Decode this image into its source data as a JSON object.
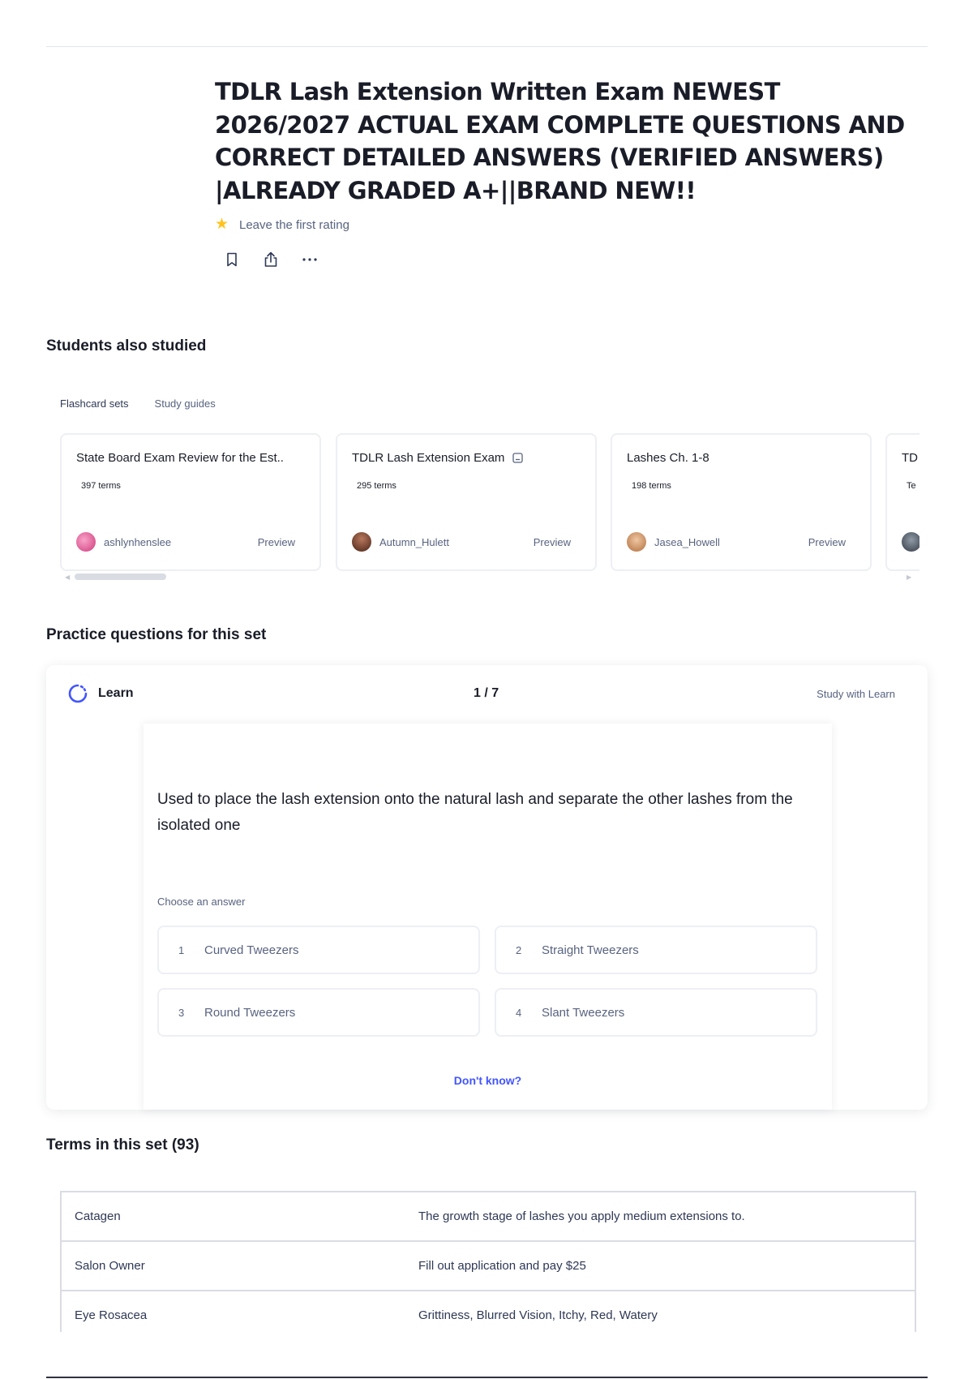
{
  "header": {
    "title": "TDLR Lash Extension Written Exam NEWEST 2026/2027 ACTUAL EXAM COMPLETE QUESTIONS AND CORRECT DETAILED ANSWERS (VERIFIED ANSWERS) |ALREADY GRADED A+||BRAND NEW!!",
    "rating_prompt": "Leave the first rating",
    "actions": [
      "bookmark-icon",
      "share-icon",
      "more-icon"
    ]
  },
  "students_also_studied": {
    "heading": "Students also studied",
    "tabs": [
      "Flashcard sets",
      "Study guides"
    ],
    "cards": [
      {
        "title": "State Board Exam Review for the Est..",
        "terms": "397 terms",
        "user": "ashlynhenslee",
        "preview": "Preview",
        "avatar_color": "#e04b8f"
      },
      {
        "title": "TDLR Lash Extension Exam",
        "terms": "295 terms",
        "user": "Autumn_Hulett",
        "preview": "Preview",
        "avatar_color": "#6a3a2c"
      },
      {
        "title": "Lashes Ch. 1-8",
        "terms": "198 terms",
        "user": "Jasea_Howell",
        "preview": "Preview",
        "avatar_color": "#c98a5a"
      },
      {
        "title": "TD",
        "terms": "Te",
        "user": "",
        "preview": "",
        "avatar_color": "#4a5563"
      }
    ]
  },
  "practice": {
    "heading": "Practice questions for this set",
    "learn_label": "Learn",
    "counter": "1 / 7",
    "study_link": "Study with Learn",
    "question": "Used to place the lash extension onto the natural lash and separate the other lashes from the isolated one",
    "choose_label": "Choose an answer",
    "options": [
      {
        "num": "1",
        "text": "Curved Tweezers"
      },
      {
        "num": "2",
        "text": "Straight Tweezers"
      },
      {
        "num": "3",
        "text": "Round Tweezers"
      },
      {
        "num": "4",
        "text": "Slant Tweezers"
      }
    ],
    "dont_know": "Don't know?"
  },
  "terms": {
    "heading": "Terms in this set (93)",
    "rows": [
      {
        "term": "Catagen",
        "definition": "The growth stage of lashes you apply medium extensions to."
      },
      {
        "term": "Salon Owner",
        "definition": "Fill out application and pay $25"
      },
      {
        "term": "Eye Rosacea",
        "definition": "Grittiness, Blurred Vision, Itchy, Red, Watery"
      }
    ]
  },
  "colors": {
    "accent": "#4255ff",
    "star": "#ffc31f",
    "text_primary": "#1a1d28",
    "text_secondary": "#586380",
    "border": "#edeff4"
  }
}
